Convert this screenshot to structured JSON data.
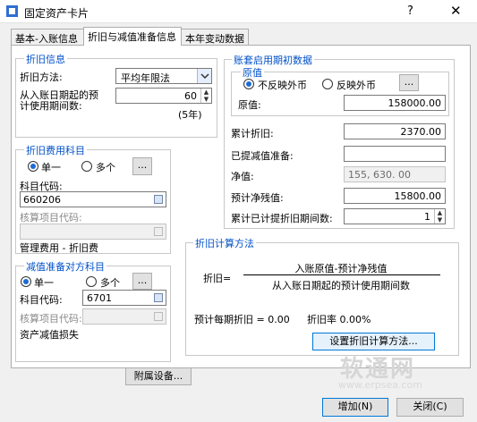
{
  "window": {
    "title": "固定资产卡片",
    "help": "?",
    "close": "✕"
  },
  "tabs": [
    {
      "label": "基本-入账信息"
    },
    {
      "label": "折旧与减值准备信息"
    },
    {
      "label": "本年变动数据"
    }
  ],
  "depr_info": {
    "legend": "折旧信息",
    "method_label": "折旧方法:",
    "method_value": "平均年限法",
    "life_label_1": "从入账日期起的预",
    "life_label_2": "计使用期间数:",
    "life_value": "60",
    "life_years": "(5年)"
  },
  "expense_account": {
    "legend": "折旧费用科目",
    "single": "单一",
    "multi": "多个",
    "more": "...",
    "code_label": "科目代码:",
    "code_value": "660206",
    "item_label": "核算项目代码:",
    "item_value": "",
    "desc": "管理费用 - 折旧费"
  },
  "impairment_account": {
    "legend": "减值准备对方科目",
    "single": "单一",
    "multi": "多个",
    "more": "...",
    "code_label": "科目代码:",
    "code_value": "6701",
    "item_label": "核算项目代码:",
    "item_value": "",
    "desc": "资产减值损失"
  },
  "initial_data": {
    "legend": "账套启用期初数据",
    "orig_legend": "原值",
    "no_fc": "不反映外币",
    "fc": "反映外币",
    "more": "...",
    "orig_label": "原值:",
    "orig_value": "158000.00",
    "accum_label": "累计折旧:",
    "accum_value": "2370.00",
    "impair_label": "已提减值准备:",
    "impair_value": "",
    "net_label": "净值:",
    "net_value": "155, 630. 00",
    "salvage_label": "预计净残值:",
    "salvage_value": "15800.00",
    "periods_label": "累计已计提折旧期间数:",
    "periods_value": "1"
  },
  "method_box": {
    "legend": "折旧计算方法",
    "lhs": "折旧=",
    "numerator": "入账原值-预计净残值",
    "denominator": "从入账日期起的预计使用期间数",
    "per_period": "预计每期折旧 = 0.00",
    "rate": "折旧率 0.00%",
    "setup_btn": "设置折旧计算方法..."
  },
  "buttons": {
    "attached": "附属设备...",
    "add": "增加(N)",
    "close": "关闭(C)"
  },
  "watermark": {
    "name": "软通网",
    "url": "www.erpsea.com"
  }
}
